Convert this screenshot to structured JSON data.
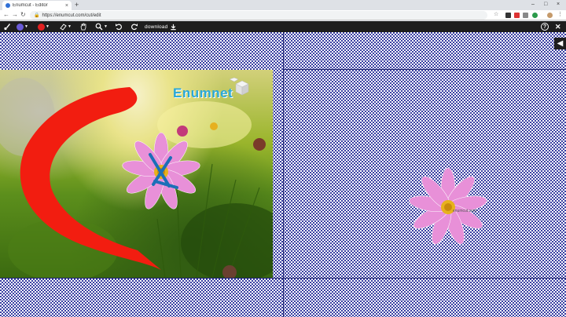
{
  "browser": {
    "tab_title": "Enumcut - Editor",
    "tab_close": "×",
    "new_tab": "+",
    "minimize": "–",
    "maximize": "□",
    "close": "×",
    "back": "←",
    "forward": "→",
    "reload": "↻",
    "url": "https://enumcut.com/cut/edit",
    "lock": "🔒"
  },
  "toolbar": {
    "brush_icon": "brush-icon",
    "foreground_color": "#6a5bd8",
    "background_color": "#e02020",
    "eraser_icon": "eraser-icon",
    "hand_icon": "hand-icon",
    "zoom_icon": "zoom-icon",
    "undo_icon": "undo-icon",
    "redo_icon": "redo-icon",
    "download_label": "download",
    "help_label": "?",
    "close_label": "✕"
  },
  "canvas": {
    "logo_text": "Enumnet",
    "watermark": "enumcut.com"
  },
  "side": {
    "collapse_label": "◀"
  }
}
